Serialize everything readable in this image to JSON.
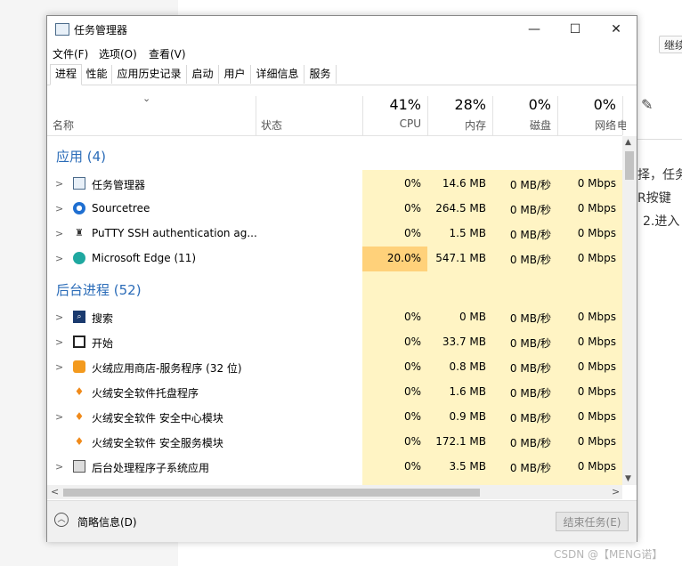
{
  "background": {
    "btn_label": "继续",
    "lines": [
      "择，任务",
      "R按键",
      "2.进入"
    ],
    "watermark": "CSDN @【MENG诺】"
  },
  "window": {
    "title": "任务管理器",
    "controls": {
      "minimize": "—",
      "maximize": "☐",
      "close": "✕"
    }
  },
  "menu": [
    "文件(F)",
    "选项(O)",
    "查看(V)"
  ],
  "tabs": [
    "进程",
    "性能",
    "应用历史记录",
    "启动",
    "用户",
    "详细信息",
    "服务"
  ],
  "header": {
    "name": "名称",
    "status": "状态",
    "cpu": {
      "pct": "41%",
      "label": "CPU"
    },
    "memory": {
      "pct": "28%",
      "label": "内存"
    },
    "disk": {
      "pct": "0%",
      "label": "磁盘"
    },
    "network": {
      "pct": "0%",
      "label": "网络"
    },
    "extra": "电"
  },
  "groups": {
    "apps": "应用 (4)",
    "background": "后台进程 (52)"
  },
  "rows": [
    {
      "name": "任务管理器",
      "cpu": "0%",
      "mem": "14.6 MB",
      "disk": "0 MB/秒",
      "net": "0 Mbps",
      "expand": true
    },
    {
      "name": "Sourcetree",
      "cpu": "0%",
      "mem": "264.5 MB",
      "disk": "0 MB/秒",
      "net": "0 Mbps",
      "expand": true
    },
    {
      "name": "PuTTY SSH authentication ag...",
      "cpu": "0%",
      "mem": "1.5 MB",
      "disk": "0 MB/秒",
      "net": "0 Mbps",
      "expand": true
    },
    {
      "name": "Microsoft Edge (11)",
      "cpu": "20.0%",
      "mem": "547.1 MB",
      "disk": "0 MB/秒",
      "net": "0 Mbps",
      "expand": true
    },
    {
      "name": "搜索",
      "cpu": "0%",
      "mem": "0 MB",
      "disk": "0 MB/秒",
      "net": "0 Mbps",
      "expand": true
    },
    {
      "name": "开始",
      "cpu": "0%",
      "mem": "33.7 MB",
      "disk": "0 MB/秒",
      "net": "0 Mbps",
      "expand": true
    },
    {
      "name": "火绒应用商店-服务程序 (32 位)",
      "cpu": "0%",
      "mem": "0.8 MB",
      "disk": "0 MB/秒",
      "net": "0 Mbps",
      "expand": true
    },
    {
      "name": "火绒安全软件托盘程序",
      "cpu": "0%",
      "mem": "1.6 MB",
      "disk": "0 MB/秒",
      "net": "0 Mbps",
      "expand": false
    },
    {
      "name": "火绒安全软件 安全中心模块",
      "cpu": "0%",
      "mem": "0.9 MB",
      "disk": "0 MB/秒",
      "net": "0 Mbps",
      "expand": true
    },
    {
      "name": "火绒安全软件 安全服务模块",
      "cpu": "0%",
      "mem": "172.1 MB",
      "disk": "0 MB/秒",
      "net": "0 Mbps",
      "expand": false
    },
    {
      "name": "后台处理程序子系统应用",
      "cpu": "0%",
      "mem": "3.5 MB",
      "disk": "0 MB/秒",
      "net": "0 Mbps",
      "expand": true
    }
  ],
  "footer": {
    "fewer_details": "简略信息(D)",
    "end_task": "结束任务(E)"
  },
  "icons": {
    "expand": "chevron-right-icon",
    "sort": "chevron-down-icon",
    "collapse": "chevron-up-icon"
  }
}
